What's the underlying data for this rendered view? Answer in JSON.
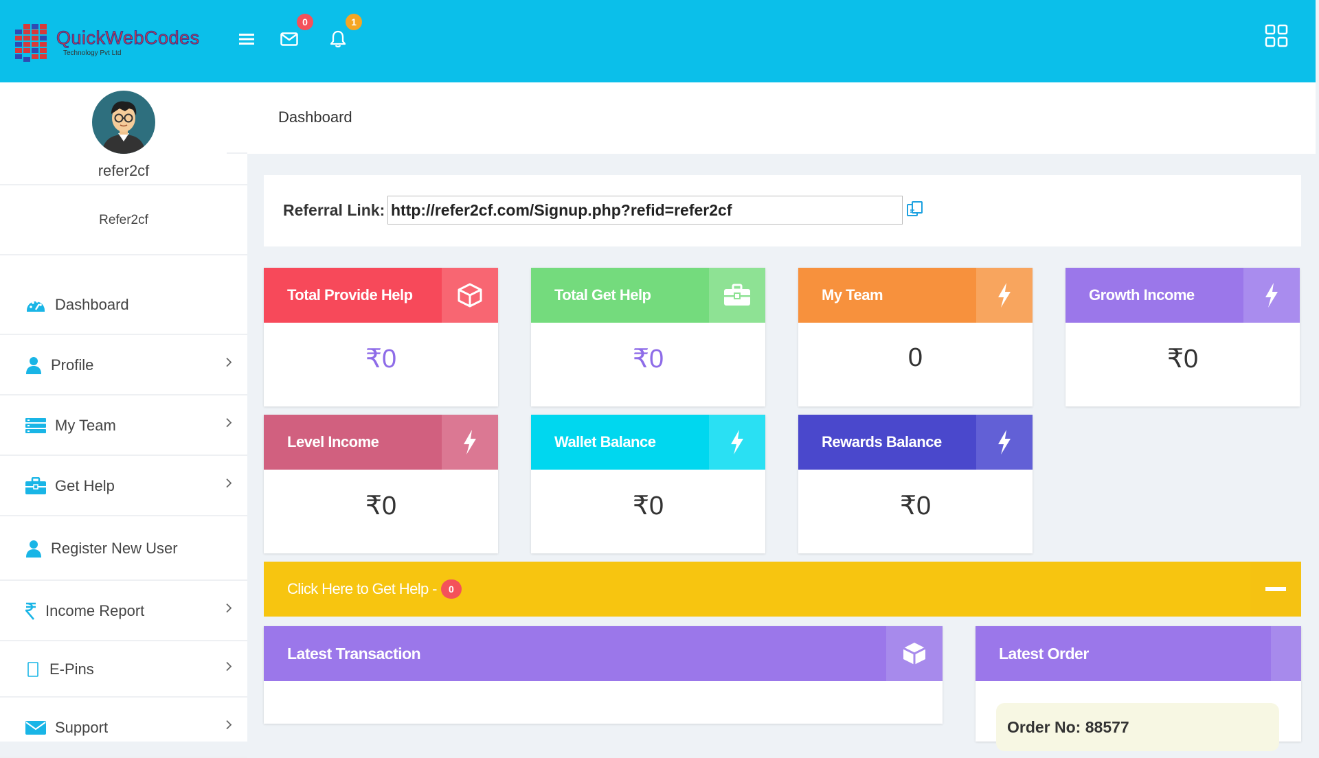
{
  "brand": {
    "name": "QuickWebCodes",
    "tagline": "Technology Pvt Ltd"
  },
  "topbar": {
    "mail_count": "0",
    "notif_count": "1"
  },
  "user": {
    "username": "refer2cf",
    "display_name": "Refer2cf"
  },
  "sidebar": {
    "items": [
      {
        "label": "Dashboard",
        "icon": "dashboard-gauge-icon"
      },
      {
        "label": "Profile",
        "icon": "user-icon",
        "has_children": true
      },
      {
        "label": "My Team",
        "icon": "team-list-icon",
        "has_children": true
      },
      {
        "label": "Get Help",
        "icon": "briefcase-icon",
        "has_children": true
      },
      {
        "label": "Register New User",
        "icon": "user-add-icon"
      },
      {
        "label": "Income Report",
        "icon": "rupee-icon",
        "has_children": true
      },
      {
        "label": "E-Pins",
        "icon": "pin-card-icon",
        "has_children": true
      },
      {
        "label": "Support",
        "icon": "envelope-icon",
        "has_children": true
      }
    ]
  },
  "page": {
    "title": "Dashboard"
  },
  "referral": {
    "label": "Referral Link:",
    "value": "http://refer2cf.com/Signup.php?refid=refer2cf"
  },
  "cards": [
    {
      "title": "Total Provide Help",
      "value": "₹0",
      "color": "#f7495a",
      "icon_bg": "#f86672",
      "icon": "cube-icon"
    },
    {
      "title": "Total Get Help",
      "value": "₹0",
      "color": "#74db7d",
      "icon_bg": "#8ee294",
      "icon": "briefcase-icon"
    },
    {
      "title": "My Team",
      "value": "0",
      "color": "#f7913d",
      "icon_bg": "#f8a55e",
      "icon": "bolt-icon"
    },
    {
      "title": "Growth Income",
      "value": "₹0",
      "color": "#9b77ea",
      "icon_bg": "#a98cee",
      "icon": "bolt-icon"
    },
    {
      "title": "Level Income",
      "value": "₹0",
      "color": "#d1607f",
      "icon_bg": "#db7893",
      "icon": "bolt-icon"
    },
    {
      "title": "Wallet Balance",
      "value": "₹0",
      "color": "#00d7ef",
      "icon_bg": "#2ae0f3",
      "icon": "bolt-icon"
    },
    {
      "title": "Rewards Balance",
      "value": "₹0",
      "color": "#4a48cc",
      "icon_bg": "#6260d6",
      "icon": "bolt-icon"
    }
  ],
  "get_help_bar": {
    "text": "Click Here to Get Help -",
    "count": "0"
  },
  "latest_transaction": {
    "title": "Latest Transaction"
  },
  "latest_order": {
    "title": "Latest Order",
    "order_text": "Order No: 88577"
  }
}
